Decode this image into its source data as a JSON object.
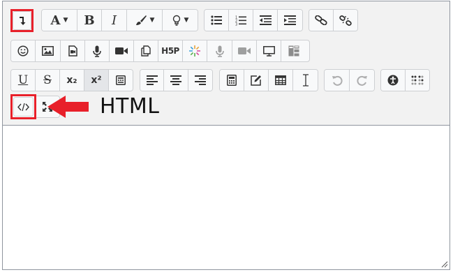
{
  "toolbar": {
    "icons": {
      "show_more": "show-more-buttons-icon",
      "font_color": "font-color-icon",
      "bold": "B",
      "italic": "I",
      "highlight": "brush-icon",
      "styles": "lightbulb-icon",
      "subscript": "x₂",
      "superscript": "x²",
      "html_toggle": "code-icon"
    }
  },
  "callout": {
    "label": "HTML",
    "accent_color": "#e8202a"
  }
}
